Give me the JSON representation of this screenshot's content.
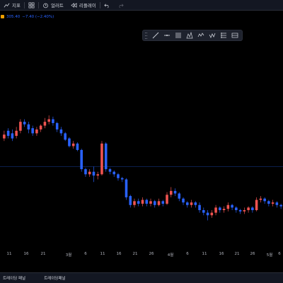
{
  "toolbar": {
    "indicators_label": "지표",
    "alert_label": "얼러트",
    "replay_label": "리플레이"
  },
  "legend": {
    "price": "305.40",
    "change": "−7.40 (−2.40%)"
  },
  "colors": {
    "up": "#ef5350",
    "down": "#2962ff",
    "background": "#000000",
    "price_line": "#2962ff"
  },
  "drawing_toolbar": {
    "tools": [
      "trend-line-icon",
      "horizontal-line-icon",
      "fib-retracement-icon",
      "pattern-icon",
      "elliott-wave-icon",
      "path-icon",
      "parallel-channel-icon",
      "regression-icon"
    ]
  },
  "x_axis": {
    "labels": [
      "11",
      "16",
      "21",
      "3월",
      "6",
      "11",
      "16",
      "21",
      "26",
      "4월",
      "6",
      "11",
      "16",
      "21",
      "26",
      "5월",
      "6"
    ]
  },
  "bottom_tabs": [
    "트레이딩 패널",
    "트레이딩패널"
  ],
  "chart_data": {
    "type": "candlestick",
    "candles": [
      {
        "o": 272,
        "c": 275,
        "h": 270,
        "l": 278
      },
      {
        "o": 278,
        "c": 274,
        "h": 272,
        "l": 280
      },
      {
        "o": 276,
        "c": 272,
        "h": 270,
        "l": 279
      },
      {
        "o": 274,
        "c": 278,
        "h": 272,
        "l": 281
      },
      {
        "o": 278,
        "c": 285,
        "h": 276,
        "l": 287
      },
      {
        "o": 285,
        "c": 283,
        "h": 281,
        "l": 287
      },
      {
        "o": 283,
        "c": 279,
        "h": 276,
        "l": 285
      },
      {
        "o": 280,
        "c": 276,
        "h": 274,
        "l": 282
      },
      {
        "o": 276,
        "c": 279,
        "h": 274,
        "l": 281
      },
      {
        "o": 279,
        "c": 282,
        "h": 277,
        "l": 283
      },
      {
        "o": 282,
        "c": 285,
        "h": 280,
        "l": 288
      },
      {
        "o": 285,
        "c": 287,
        "h": 283,
        "l": 290
      },
      {
        "o": 287,
        "c": 284,
        "h": 282,
        "l": 289
      },
      {
        "o": 284,
        "c": 279,
        "h": 277,
        "l": 285
      },
      {
        "o": 279,
        "c": 276,
        "h": 274,
        "l": 281
      },
      {
        "o": 276,
        "c": 271,
        "h": 270,
        "l": 277
      },
      {
        "o": 272,
        "c": 266,
        "h": 265,
        "l": 273
      },
      {
        "o": 266,
        "c": 268,
        "h": 264,
        "l": 270
      },
      {
        "o": 268,
        "c": 263,
        "h": 262,
        "l": 269
      },
      {
        "o": 263,
        "c": 248,
        "h": 246,
        "l": 264
      },
      {
        "o": 248,
        "c": 244,
        "h": 242,
        "l": 249
      },
      {
        "o": 244,
        "c": 246,
        "h": 242,
        "l": 248
      },
      {
        "o": 246,
        "c": 243,
        "h": 238,
        "l": 250
      },
      {
        "o": 243,
        "c": 244,
        "h": 240,
        "l": 246
      },
      {
        "o": 244,
        "c": 268,
        "h": 243,
        "l": 270
      },
      {
        "o": 268,
        "c": 248,
        "h": 246,
        "l": 269
      },
      {
        "o": 248,
        "c": 246,
        "h": 244,
        "l": 249
      },
      {
        "o": 246,
        "c": 244,
        "h": 242,
        "l": 247
      },
      {
        "o": 244,
        "c": 241,
        "h": 239,
        "l": 245
      },
      {
        "o": 241,
        "c": 240,
        "h": 238,
        "l": 242
      },
      {
        "o": 240,
        "c": 226,
        "h": 224,
        "l": 241
      },
      {
        "o": 227,
        "c": 220,
        "h": 218,
        "l": 228
      },
      {
        "o": 220,
        "c": 223,
        "h": 218,
        "l": 225
      },
      {
        "o": 223,
        "c": 221,
        "h": 219,
        "l": 225
      },
      {
        "o": 221,
        "c": 224,
        "h": 219,
        "l": 226
      },
      {
        "o": 224,
        "c": 221,
        "h": 219,
        "l": 225
      },
      {
        "o": 221,
        "c": 223,
        "h": 219,
        "l": 225
      },
      {
        "o": 223,
        "c": 220,
        "h": 218,
        "l": 224
      },
      {
        "o": 220,
        "c": 223,
        "h": 219,
        "l": 225
      },
      {
        "o": 223,
        "c": 221,
        "h": 219,
        "l": 224
      },
      {
        "o": 221,
        "c": 228,
        "h": 220,
        "l": 230
      },
      {
        "o": 228,
        "c": 231,
        "h": 226,
        "l": 234
      },
      {
        "o": 231,
        "c": 229,
        "h": 227,
        "l": 233
      },
      {
        "o": 229,
        "c": 225,
        "h": 223,
        "l": 230
      },
      {
        "o": 225,
        "c": 222,
        "h": 220,
        "l": 226
      },
      {
        "o": 222,
        "c": 220,
        "h": 218,
        "l": 223
      },
      {
        "o": 220,
        "c": 222,
        "h": 218,
        "l": 224
      },
      {
        "o": 222,
        "c": 220,
        "h": 218,
        "l": 223
      },
      {
        "o": 220,
        "c": 216,
        "h": 214,
        "l": 222
      },
      {
        "o": 216,
        "c": 214,
        "h": 212,
        "l": 218
      },
      {
        "o": 214,
        "c": 212,
        "h": 208,
        "l": 216
      },
      {
        "o": 212,
        "c": 214,
        "h": 210,
        "l": 216
      },
      {
        "o": 214,
        "c": 218,
        "h": 212,
        "l": 220
      },
      {
        "o": 218,
        "c": 216,
        "h": 214,
        "l": 219
      },
      {
        "o": 216,
        "c": 217,
        "h": 214,
        "l": 219
      },
      {
        "o": 217,
        "c": 220,
        "h": 215,
        "l": 222
      },
      {
        "o": 220,
        "c": 218,
        "h": 216,
        "l": 221
      },
      {
        "o": 218,
        "c": 216,
        "h": 214,
        "l": 219
      },
      {
        "o": 216,
        "c": 215,
        "h": 213,
        "l": 217
      },
      {
        "o": 215,
        "c": 216,
        "h": 213,
        "l": 218
      },
      {
        "o": 216,
        "c": 218,
        "h": 214,
        "l": 219
      },
      {
        "o": 218,
        "c": 216,
        "h": 214,
        "l": 219
      },
      {
        "o": 216,
        "c": 224,
        "h": 215,
        "l": 226
      },
      {
        "o": 224,
        "c": 225,
        "h": 222,
        "l": 227
      },
      {
        "o": 225,
        "c": 223,
        "h": 221,
        "l": 226
      },
      {
        "o": 223,
        "c": 221,
        "h": 219,
        "l": 224
      },
      {
        "o": 221,
        "c": 222,
        "h": 219,
        "l": 224
      },
      {
        "o": 222,
        "c": 220,
        "h": 218,
        "l": 223
      },
      {
        "o": 220,
        "c": 219,
        "h": 217,
        "l": 221
      }
    ],
    "price_line": 250
  }
}
